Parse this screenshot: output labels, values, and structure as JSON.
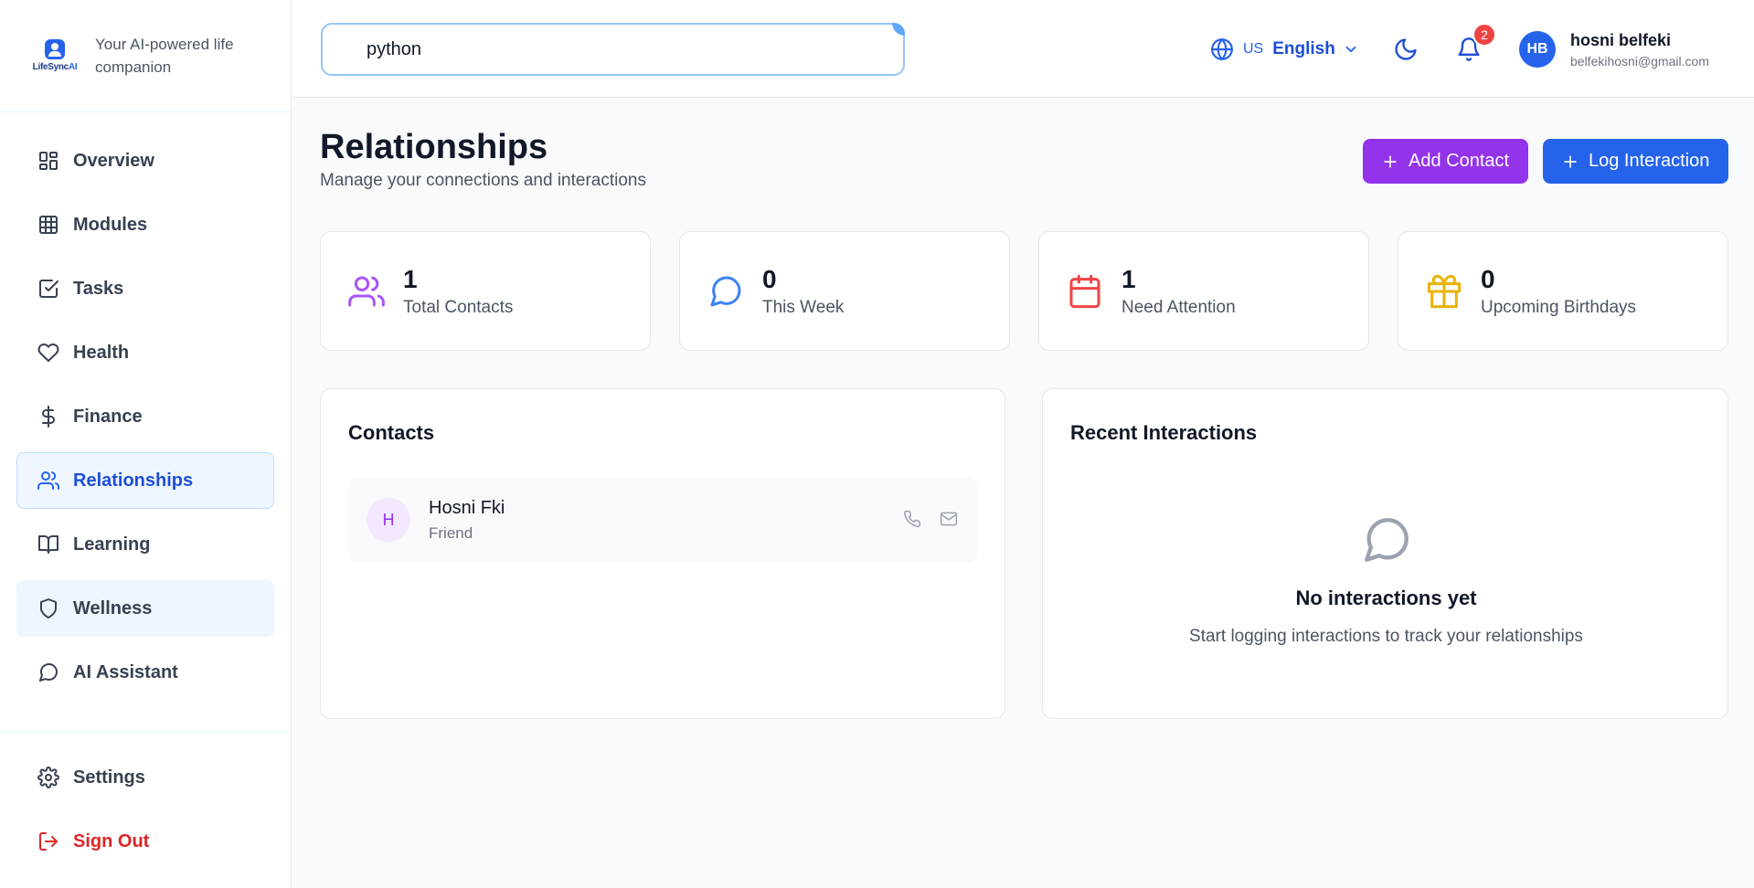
{
  "brand": {
    "logo_text": "LifeSync",
    "logo_ai": "AI",
    "tagline": "Your AI-powered life companion"
  },
  "sidebar": {
    "items": [
      {
        "label": "Overview",
        "icon": "layout-dashboard-icon"
      },
      {
        "label": "Modules",
        "icon": "grid-icon"
      },
      {
        "label": "Tasks",
        "icon": "checkbox-icon"
      },
      {
        "label": "Health",
        "icon": "heart-icon"
      },
      {
        "label": "Finance",
        "icon": "dollar-icon"
      },
      {
        "label": "Relationships",
        "icon": "users-icon",
        "active": true
      },
      {
        "label": "Learning",
        "icon": "book-icon"
      },
      {
        "label": "Wellness",
        "icon": "shield-icon"
      },
      {
        "label": "AI Assistant",
        "icon": "message-circle-icon"
      }
    ],
    "bottom": [
      {
        "label": "Settings",
        "icon": "gear-icon"
      },
      {
        "label": "Sign Out",
        "icon": "logout-icon"
      }
    ]
  },
  "header": {
    "search_value": "python",
    "language_code": "US",
    "language_name": "English",
    "notification_count": "2",
    "user": {
      "initials": "HB",
      "name": "hosni belfeki",
      "email": "belfekihosni@gmail.com"
    }
  },
  "page": {
    "title": "Relationships",
    "subtitle": "Manage your connections and interactions",
    "add_contact_label": "Add Contact",
    "log_interaction_label": "Log Interaction"
  },
  "stats": [
    {
      "value": "1",
      "label": "Total Contacts",
      "icon": "users-icon",
      "color": "#a855f7"
    },
    {
      "value": "0",
      "label": "This Week",
      "icon": "message-circle-icon",
      "color": "#3b82f6"
    },
    {
      "value": "1",
      "label": "Need Attention",
      "icon": "calendar-icon",
      "color": "#ef4444"
    },
    {
      "value": "0",
      "label": "Upcoming Birthdays",
      "icon": "gift-icon",
      "color": "#eab308"
    }
  ],
  "contacts": {
    "title": "Contacts",
    "items": [
      {
        "initial": "H",
        "name": "Hosni Fki",
        "relation": "Friend"
      }
    ]
  },
  "interactions": {
    "title": "Recent Interactions",
    "empty_title": "No interactions yet",
    "empty_subtitle": "Start logging interactions to track your relationships"
  },
  "colors": {
    "accent": "#2563eb",
    "purple": "#9333ea",
    "danger": "#dc2626"
  }
}
